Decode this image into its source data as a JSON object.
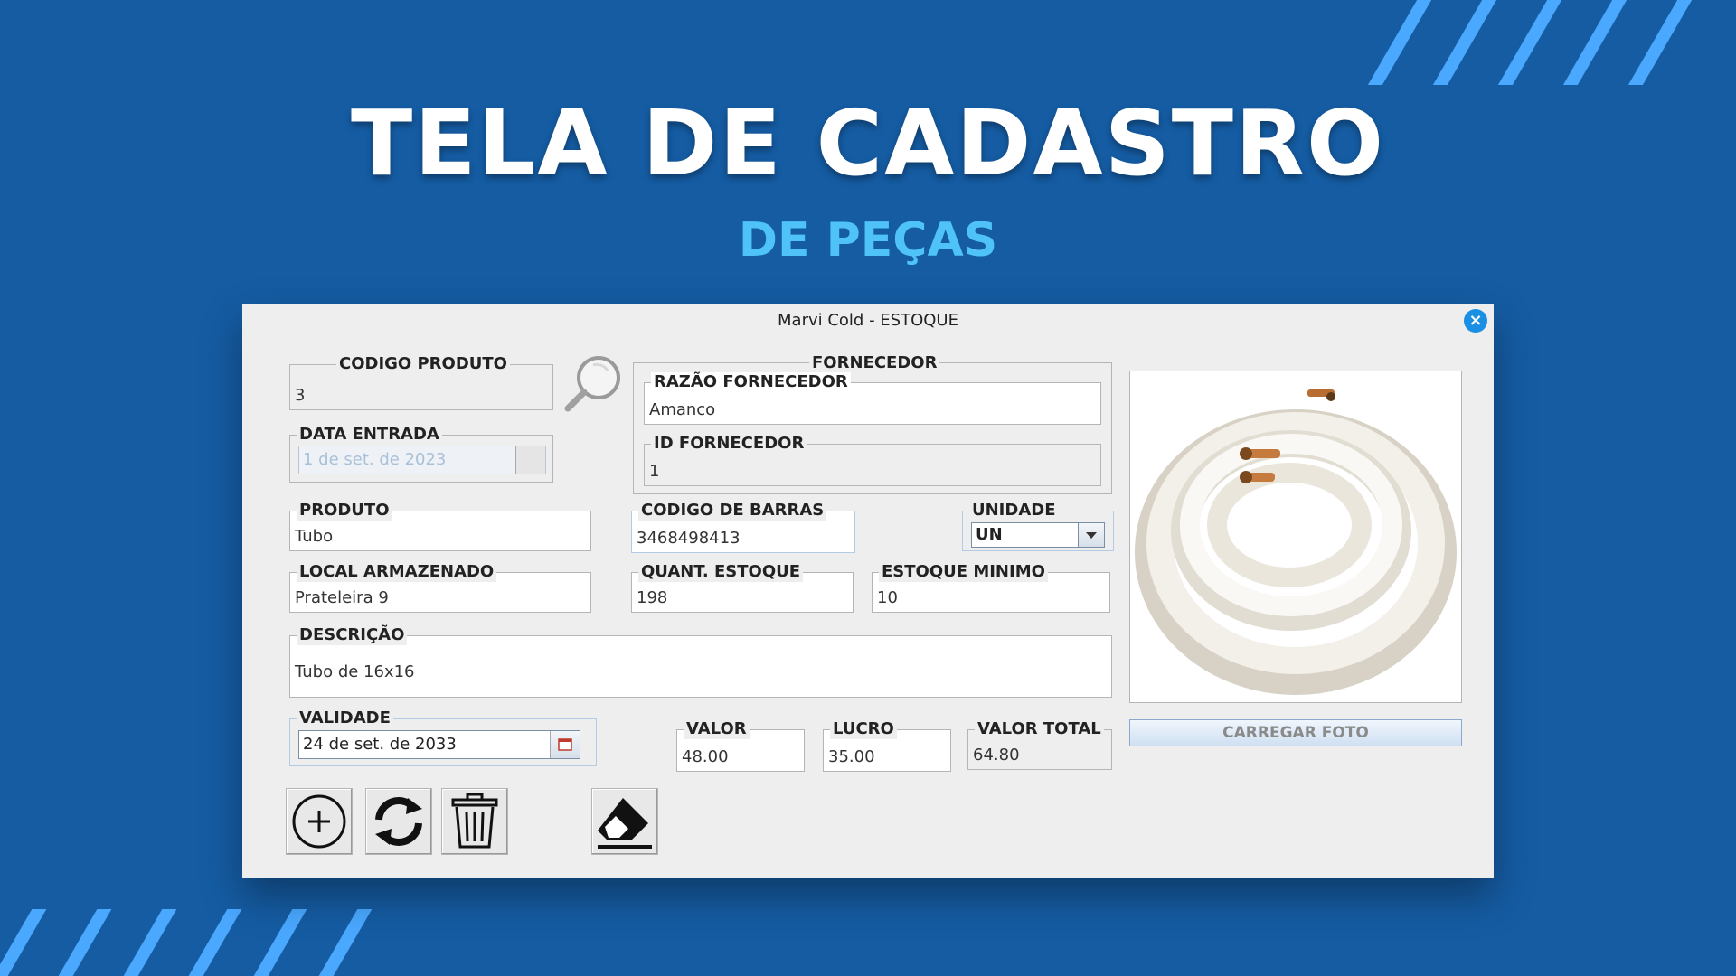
{
  "banner": {
    "title": "TELA DE CADASTRO",
    "subtitle": "DE PEÇAS"
  },
  "window": {
    "title": "Marvi Cold - ESTOQUE",
    "close_icon": "close-icon"
  },
  "form": {
    "codigo_produto": {
      "label": "CODIGO PRODUTO",
      "value": "3"
    },
    "data_entrada": {
      "label": "DATA ENTRADA",
      "value": "1 de set. de 2023"
    },
    "fornecedor": {
      "group_label": "FORNECEDOR",
      "razao": {
        "label": "RAZÃO FORNECEDOR",
        "value": "Amanco"
      },
      "id": {
        "label": "ID FORNECEDOR",
        "value": "1"
      }
    },
    "produto": {
      "label": "PRODUTO",
      "value": "Tubo"
    },
    "codigo_barras": {
      "label": "CODIGO DE BARRAS",
      "value": "3468498413"
    },
    "unidade": {
      "label": "UNIDADE",
      "value": "UN"
    },
    "local": {
      "label": "LOCAL ARMAZENADO",
      "value": "Prateleira 9"
    },
    "quant_estoque": {
      "label": "QUANT. ESTOQUE",
      "value": "198"
    },
    "estoque_minimo": {
      "label": "ESTOQUE MINIMO",
      "value": "10"
    },
    "descricao": {
      "label": "DESCRIÇÃO",
      "value": "Tubo de 16x16"
    },
    "validade": {
      "label": "VALIDADE",
      "value": "24 de set. de 2033"
    },
    "valor": {
      "label": "VALOR",
      "value": "48.00"
    },
    "lucro": {
      "label": "LUCRO",
      "value": "35.00"
    },
    "valor_total": {
      "label": "VALOR TOTAL",
      "value": "64.80"
    }
  },
  "photo": {
    "button_label": "CARREGAR FOTO"
  },
  "colors": {
    "background": "#155ca3",
    "stripes": "#4aa8ff",
    "subtitle": "#4fc3f7",
    "close_button": "#1a8fe3"
  }
}
